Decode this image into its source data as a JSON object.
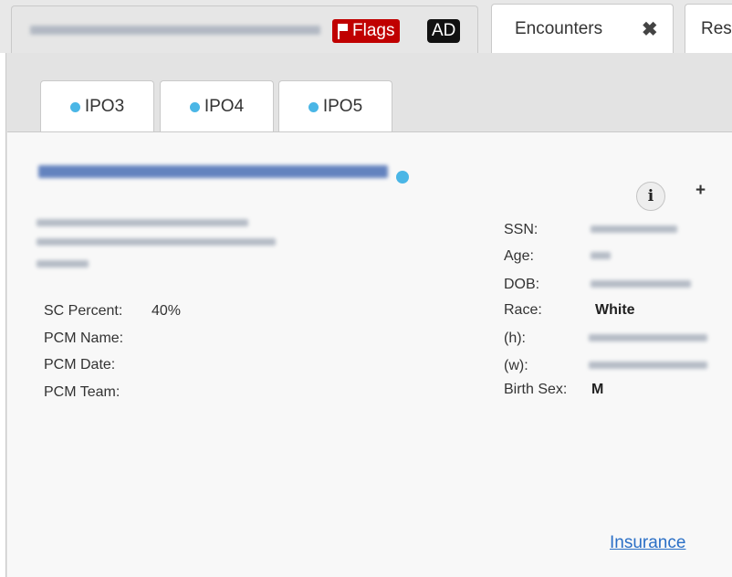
{
  "top_tabs": {
    "patient_tab": {
      "name_redacted": "",
      "flags_label": "Flags",
      "ad_label": "AD"
    },
    "encounters_tab": {
      "label": "Encounters",
      "close_icon": "close-icon"
    },
    "next_tab": {
      "label": "Res"
    }
  },
  "sub_tabs": [
    {
      "label": "IPO3",
      "status_color": "#4ab6e6"
    },
    {
      "label": "IPO4",
      "status_color": "#4ab6e6"
    },
    {
      "label": "IPO5",
      "status_color": "#4ab6e6"
    }
  ],
  "patient": {
    "name_redacted": "",
    "address_redacted": "",
    "left_fields": [
      {
        "label": "SC Percent:",
        "value": "40%"
      },
      {
        "label": "PCM Name:",
        "value": ""
      },
      {
        "label": "PCM Date:",
        "value": ""
      },
      {
        "label": "PCM Team:",
        "value": ""
      }
    ],
    "right_fields": {
      "ssn_label": "SSN:",
      "age_label": "Age:",
      "dob_label": "DOB:",
      "race_label": "Race:",
      "race_value": "White",
      "home_phone_label": "(h):",
      "work_phone_label": "(w):",
      "birth_sex_label": "Birth Sex:",
      "birth_sex_value": "M"
    }
  },
  "actions": {
    "info_label": "i",
    "add_label": "+",
    "insurance_link": "Insurance"
  },
  "colors": {
    "flags_bg": "#c00000",
    "ad_bg": "#111111",
    "status_dot": "#4ab6e6",
    "link": "#2a6fc6"
  }
}
